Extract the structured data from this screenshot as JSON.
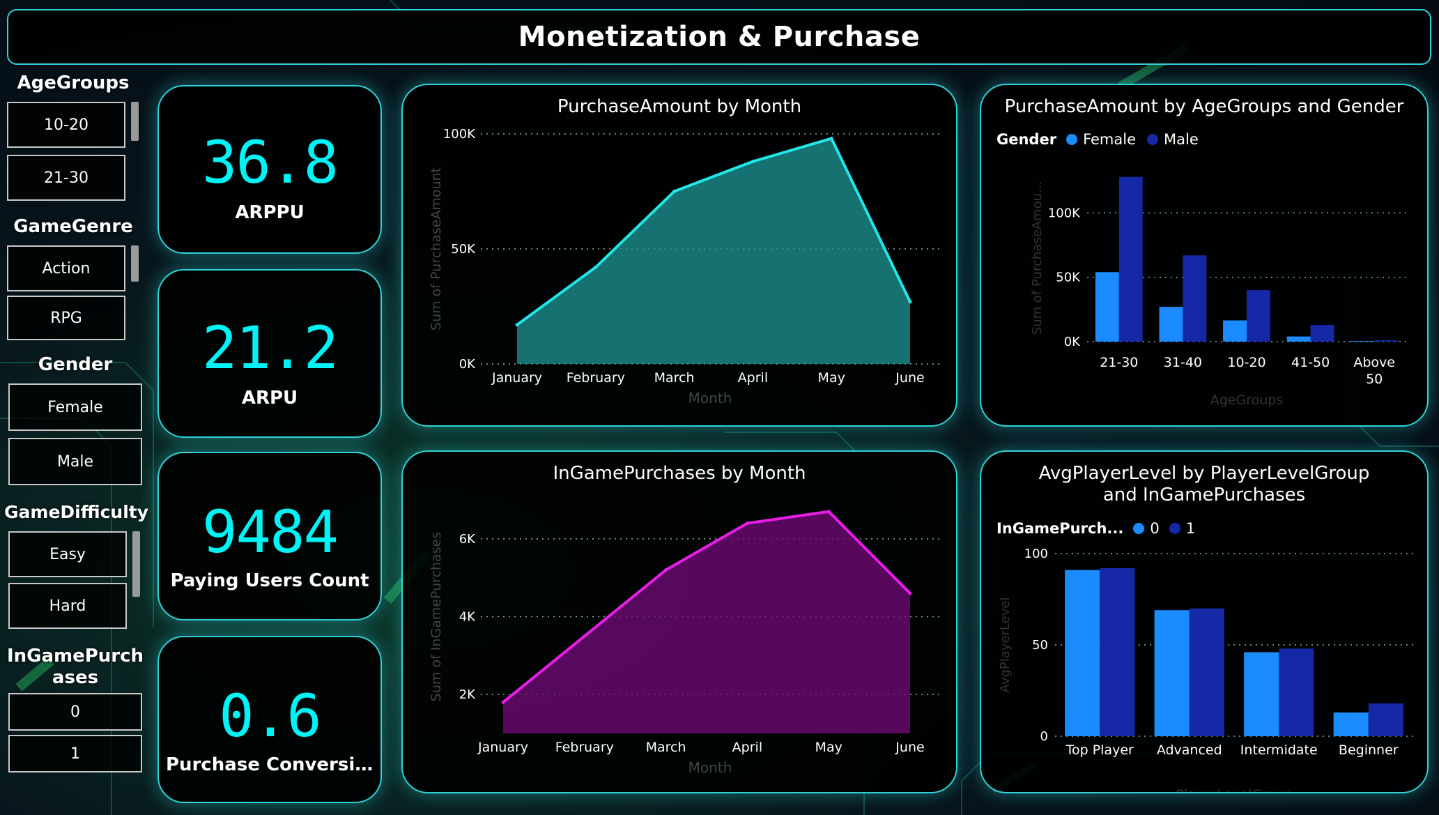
{
  "title": "Monetization & Purchase",
  "slicers": {
    "age_groups": {
      "title": "AgeGroups",
      "items": [
        "10-20",
        "21-30"
      ]
    },
    "game_genre": {
      "title": "GameGenre",
      "items": [
        "Action",
        "RPG"
      ]
    },
    "gender": {
      "title": "Gender",
      "items": [
        "Female",
        "Male"
      ]
    },
    "game_difficulty": {
      "title": "GameDifficulty",
      "items": [
        "Easy",
        "Hard"
      ]
    },
    "ingame_purchases": {
      "title": "InGamePurchases",
      "items": [
        "0",
        "1"
      ]
    }
  },
  "kpis": [
    {
      "value": "36.8",
      "label": "ARPPU"
    },
    {
      "value": "21.2",
      "label": "ARPU"
    },
    {
      "value": "9484",
      "label": "Paying Users Count"
    },
    {
      "value": "0.6",
      "label": "Purchase Conversio..."
    }
  ],
  "colors": {
    "accent": "#2fd3d6",
    "kpi": "#00f3f5",
    "cyan_line": "#22e5e8",
    "cyan_fill": "#1a8f8c",
    "magenta_line": "#e81ee8",
    "magenta_fill": "#6d0a74",
    "female": "#1a8cff",
    "male": "#1528a6"
  },
  "chart_data": [
    {
      "type": "area",
      "title": "PurchaseAmount by Month",
      "xlabel": "Month",
      "ylabel": "Sum of PurchaseAmount",
      "categories": [
        "January",
        "February",
        "March",
        "April",
        "May",
        "June"
      ],
      "values": [
        17000,
        42000,
        75000,
        88000,
        98000,
        27000
      ],
      "yticks": [
        "0K",
        "50K",
        "100K"
      ],
      "ylim": [
        0,
        100000
      ],
      "grid": true
    },
    {
      "type": "bar",
      "title": "PurchaseAmount by AgeGroups and Gender",
      "xlabel": "AgeGroups",
      "ylabel": "Sum of PurchaseAmou...",
      "legend_title": "Gender",
      "categories": [
        "21-30",
        "31-40",
        "10-20",
        "41-50",
        "Above 50"
      ],
      "series": [
        {
          "name": "Female",
          "values": [
            54000,
            27000,
            16500,
            4000,
            500
          ]
        },
        {
          "name": "Male",
          "values": [
            128000,
            67000,
            40000,
            13000,
            1000
          ]
        }
      ],
      "yticks": [
        "0K",
        "50K",
        "100K"
      ],
      "ylim": [
        0,
        130000
      ],
      "grid": true
    },
    {
      "type": "area",
      "title": "InGamePurchases by Month",
      "xlabel": "Month",
      "ylabel": "Sum of InGamePurchases",
      "categories": [
        "January",
        "February",
        "March",
        "April",
        "May",
        "June"
      ],
      "values": [
        1800,
        3500,
        5200,
        6400,
        6700,
        4600
      ],
      "yticks": [
        "2K",
        "4K",
        "6K"
      ],
      "ylim": [
        1000,
        7000
      ],
      "grid": true
    },
    {
      "type": "bar",
      "title": "AvgPlayerLevel by PlayerLevelGroup and InGamePurchases",
      "xlabel": "PlayerLevelGroup",
      "ylabel": "AvgPlayerLevel",
      "legend_title": "InGamePurch...",
      "categories": [
        "Top Player",
        "Advanced",
        "Intermidate",
        "Beginner"
      ],
      "series": [
        {
          "name": "0",
          "values": [
            91,
            69,
            46,
            13
          ]
        },
        {
          "name": "1",
          "values": [
            92,
            70,
            48,
            18
          ]
        }
      ],
      "yticks": [
        "0",
        "50",
        "100"
      ],
      "ylim": [
        0,
        100
      ],
      "grid": true
    }
  ]
}
